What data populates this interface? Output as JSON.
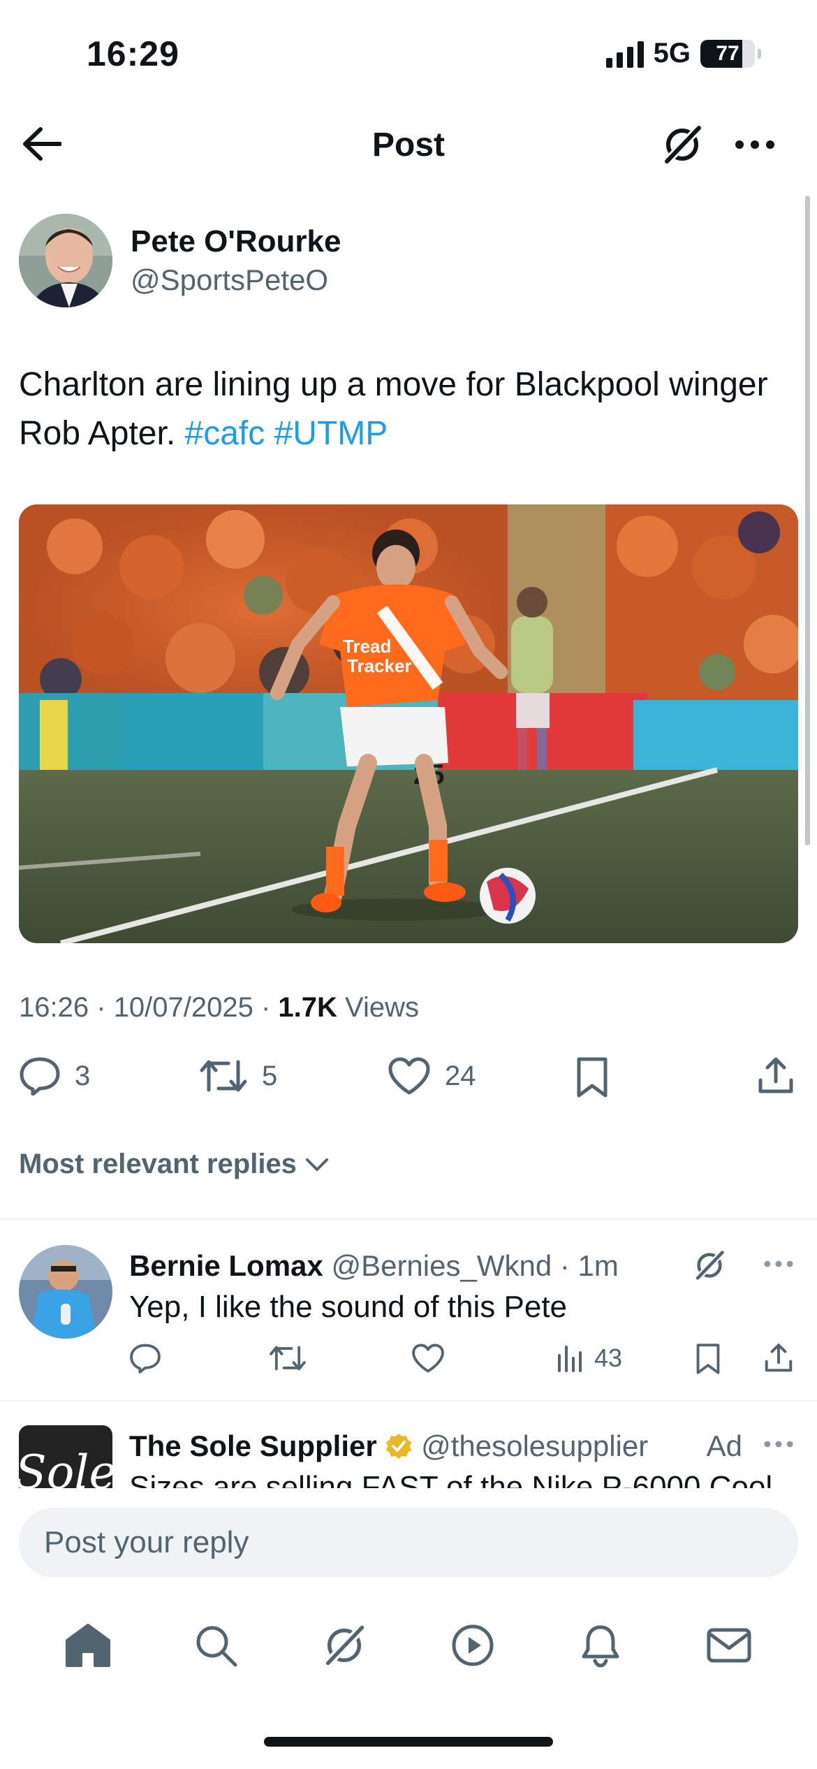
{
  "status_bar": {
    "time": "16:29",
    "network": "5G",
    "battery": "77",
    "battery_level": 0.77
  },
  "header": {
    "title": "Post"
  },
  "tweet": {
    "author_name": "Pete O'Rourke",
    "author_handle": "@SportsPeteO",
    "text": "Charlton are lining up a move for Blackpool winger Rob Apter.",
    "hashtags": [
      "#cafc",
      "#UTMP"
    ],
    "image": {
      "shirt_sponsor_line1": "Tread",
      "shirt_sponsor_line2": "Tracker",
      "shirt_number": "25"
    },
    "timestamp": "16:26 · 10/07/2025 · ",
    "views_count": "1.7K",
    "views_label": " Views",
    "replies": "3",
    "reposts": "5",
    "likes": "24"
  },
  "replies_sort": {
    "label": "Most relevant replies"
  },
  "replies": [
    {
      "name": "Bernie Lomax",
      "handle": "@Bernies_Wknd",
      "time": "· 1m",
      "text": "Yep, I like the sound of this Pete",
      "views": "43"
    }
  ],
  "ad": {
    "name": "The Sole Supplier",
    "handle": "@thesolesupplier",
    "label": "Ad",
    "text": "Sizes are selling FAST of the Nike P-6000 Cool",
    "logo_text": "Sole"
  },
  "reply_bar": {
    "placeholder": "Post your reply"
  },
  "colors": {
    "accent": "#1d9bf0",
    "secondary_text": "#536471",
    "verified_gold": "#e8b829",
    "blackpool_orange": "#ff6b1a"
  },
  "tab_bar": {
    "icons": [
      "home-icon",
      "search-icon",
      "grok-icon",
      "video-icon",
      "notifications-icon",
      "messages-icon"
    ]
  }
}
